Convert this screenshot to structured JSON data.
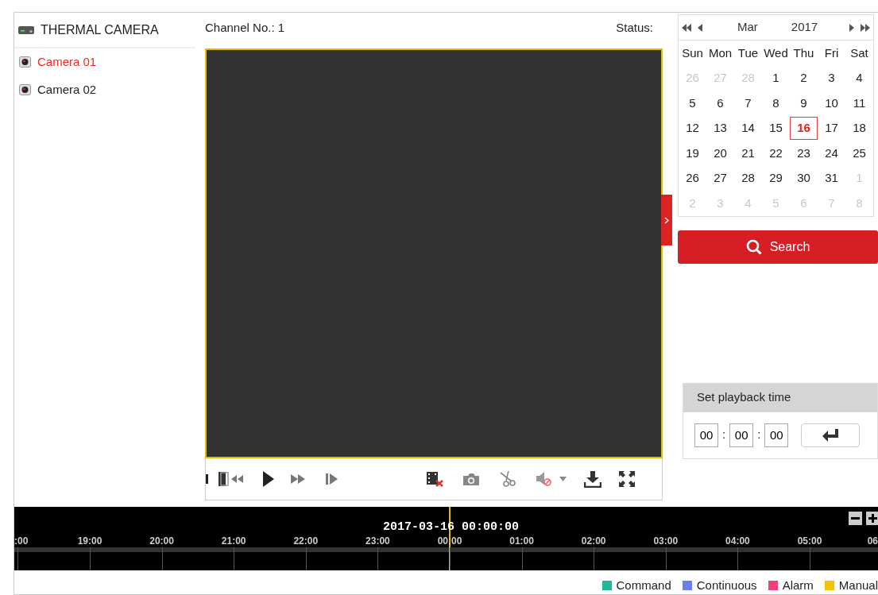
{
  "header": {
    "device": "THERMAL CAMERA",
    "channel_label": "Channel No.: 1",
    "status_label": "Status:"
  },
  "cameras": [
    {
      "label": "Camera 01",
      "selected": true
    },
    {
      "label": "Camera 02",
      "selected": false
    }
  ],
  "calendar": {
    "month": "Mar",
    "year": "2017",
    "weekdays": [
      "Sun",
      "Mon",
      "Tue",
      "Wed",
      "Thu",
      "Fri",
      "Sat"
    ],
    "weeks": [
      [
        {
          "label": "26",
          "muted": true,
          "selected": false
        },
        {
          "label": "27",
          "muted": true,
          "selected": false
        },
        {
          "label": "28",
          "muted": true,
          "selected": false
        },
        {
          "label": "1",
          "muted": false,
          "selected": false
        },
        {
          "label": "2",
          "muted": false,
          "selected": false
        },
        {
          "label": "3",
          "muted": false,
          "selected": false
        },
        {
          "label": "4",
          "muted": false,
          "selected": false
        }
      ],
      [
        {
          "label": "5",
          "muted": false,
          "selected": false
        },
        {
          "label": "6",
          "muted": false,
          "selected": false
        },
        {
          "label": "7",
          "muted": false,
          "selected": false
        },
        {
          "label": "8",
          "muted": false,
          "selected": false
        },
        {
          "label": "9",
          "muted": false,
          "selected": false
        },
        {
          "label": "10",
          "muted": false,
          "selected": false
        },
        {
          "label": "11",
          "muted": false,
          "selected": false
        }
      ],
      [
        {
          "label": "12",
          "muted": false,
          "selected": false
        },
        {
          "label": "13",
          "muted": false,
          "selected": false
        },
        {
          "label": "14",
          "muted": false,
          "selected": false
        },
        {
          "label": "15",
          "muted": false,
          "selected": false
        },
        {
          "label": "16",
          "muted": false,
          "selected": true
        },
        {
          "label": "17",
          "muted": false,
          "selected": false
        },
        {
          "label": "18",
          "muted": false,
          "selected": false
        }
      ],
      [
        {
          "label": "19",
          "muted": false,
          "selected": false
        },
        {
          "label": "20",
          "muted": false,
          "selected": false
        },
        {
          "label": "21",
          "muted": false,
          "selected": false
        },
        {
          "label": "22",
          "muted": false,
          "selected": false
        },
        {
          "label": "23",
          "muted": false,
          "selected": false
        },
        {
          "label": "24",
          "muted": false,
          "selected": false
        },
        {
          "label": "25",
          "muted": false,
          "selected": false
        }
      ],
      [
        {
          "label": "26",
          "muted": false,
          "selected": false
        },
        {
          "label": "27",
          "muted": false,
          "selected": false
        },
        {
          "label": "28",
          "muted": false,
          "selected": false
        },
        {
          "label": "29",
          "muted": false,
          "selected": false
        },
        {
          "label": "30",
          "muted": false,
          "selected": false
        },
        {
          "label": "31",
          "muted": false,
          "selected": false
        },
        {
          "label": "1",
          "muted": true,
          "selected": false
        }
      ],
      [
        {
          "label": "2",
          "muted": true,
          "selected": false
        },
        {
          "label": "3",
          "muted": true,
          "selected": false
        },
        {
          "label": "4",
          "muted": true,
          "selected": false
        },
        {
          "label": "5",
          "muted": true,
          "selected": false
        },
        {
          "label": "6",
          "muted": true,
          "selected": false
        },
        {
          "label": "7",
          "muted": true,
          "selected": false
        },
        {
          "label": "8",
          "muted": true,
          "selected": false
        }
      ]
    ]
  },
  "search_button": "Search",
  "playback_time": {
    "title": "Set playback time",
    "hours": "00",
    "minutes": "00",
    "seconds": "00",
    "separator": ":"
  },
  "timeline": {
    "cursor_label": "2017-03-16 00:00:00",
    "hours": [
      ":00",
      "19:00",
      "20:00",
      "21:00",
      "22:00",
      "23:00",
      "00:00",
      "01:00",
      "02:00",
      "03:00",
      "04:00",
      "05:00",
      "06"
    ]
  },
  "legend": [
    {
      "label": "Command",
      "color": "#1fb99a"
    },
    {
      "label": "Continuous",
      "color": "#6a7ff0"
    },
    {
      "label": "Alarm",
      "color": "#f0407a"
    },
    {
      "label": "Manual",
      "color": "#f5c400"
    }
  ]
}
